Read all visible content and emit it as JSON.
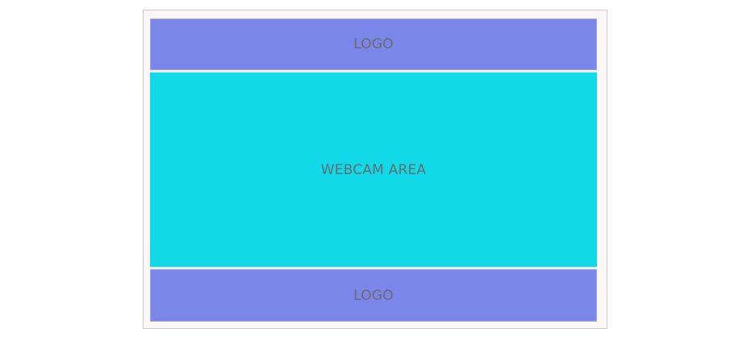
{
  "layout": {
    "top_logo": {
      "label": "LOGO"
    },
    "webcam": {
      "label": "WEBCAM AREA"
    },
    "bottom_logo": {
      "label": "LOGO"
    }
  },
  "colors": {
    "logo_bg": "#7b87e8",
    "webcam_bg": "#11d9e8",
    "frame_bg": "#fdf8f8",
    "text": "#6b6b78"
  }
}
